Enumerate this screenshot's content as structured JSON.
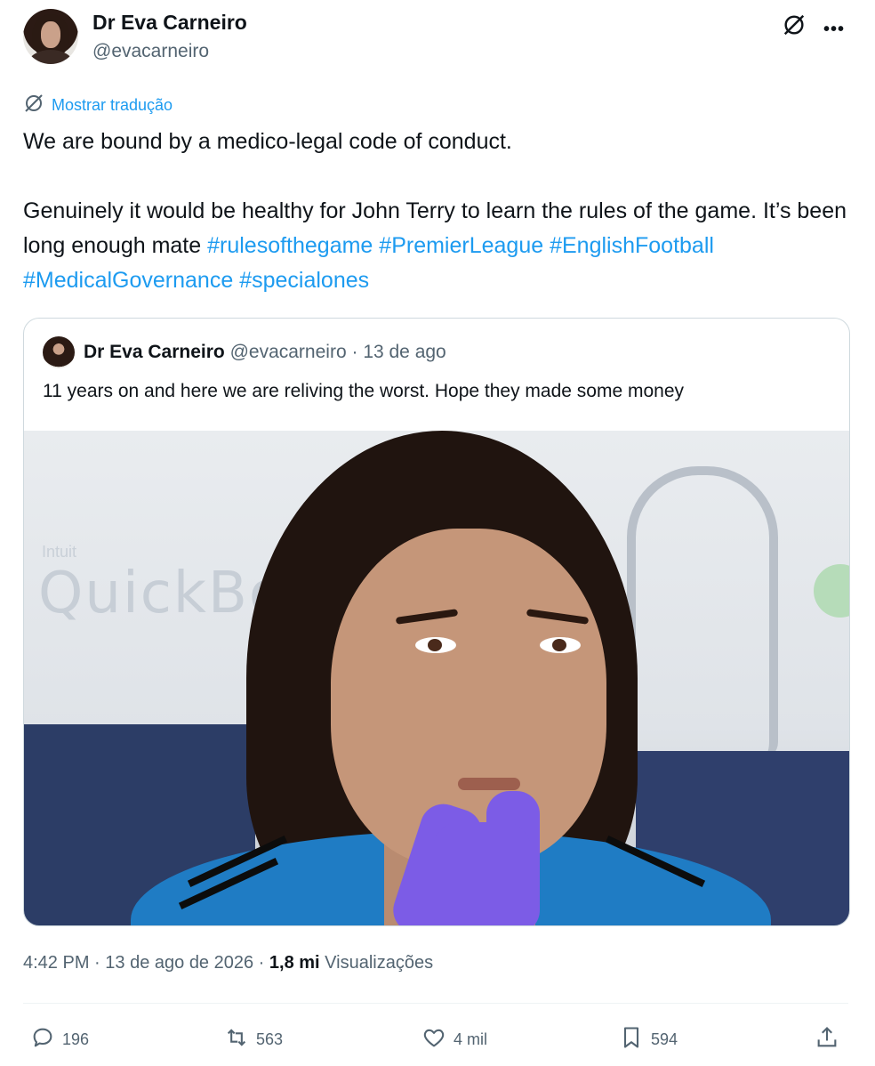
{
  "author": {
    "display_name": "Dr Eva Carneiro",
    "handle": "@evacarneiro"
  },
  "translate": {
    "label": "Mostrar tradução"
  },
  "tweet": {
    "line1": "We are bound by a medico-legal code of conduct.",
    "line2_text": "Genuinely it would be healthy for John Terry to learn the rules of the game. It’s been long enough mate ",
    "hashtags": [
      "#rulesofthegame",
      "#PremierLeague",
      "#EnglishFootball",
      "#MedicalGovernance",
      "#specialones"
    ]
  },
  "quote": {
    "display_name": "Dr Eva Carneiro",
    "handle": "@evacarneiro",
    "separator": "·",
    "date": "13 de ago",
    "text": "11 years on and here we are reliving the worst. Hope they made some money",
    "image_watermark": "QuickBook",
    "image_watermark_small": "Intuit"
  },
  "meta": {
    "time": "4:42 PM",
    "sep1": "·",
    "date": "13 de ago de 2026",
    "sep2": "·",
    "views_count": "1,8 mi",
    "views_label": "Visualizações"
  },
  "actions": {
    "replies": "196",
    "reposts": "563",
    "likes": "4 mil",
    "bookmarks": "594"
  },
  "icons": {
    "translate": "globe-slash-icon",
    "grok": "grok-icon",
    "more": "more-icon",
    "reply": "reply-icon",
    "repost": "repost-icon",
    "like": "heart-icon",
    "bookmark": "bookmark-icon",
    "share": "share-icon"
  },
  "colors": {
    "link": "#1d9bf0",
    "secondary_text": "#536471",
    "primary_text": "#0f1419",
    "border": "#cfd9de"
  }
}
